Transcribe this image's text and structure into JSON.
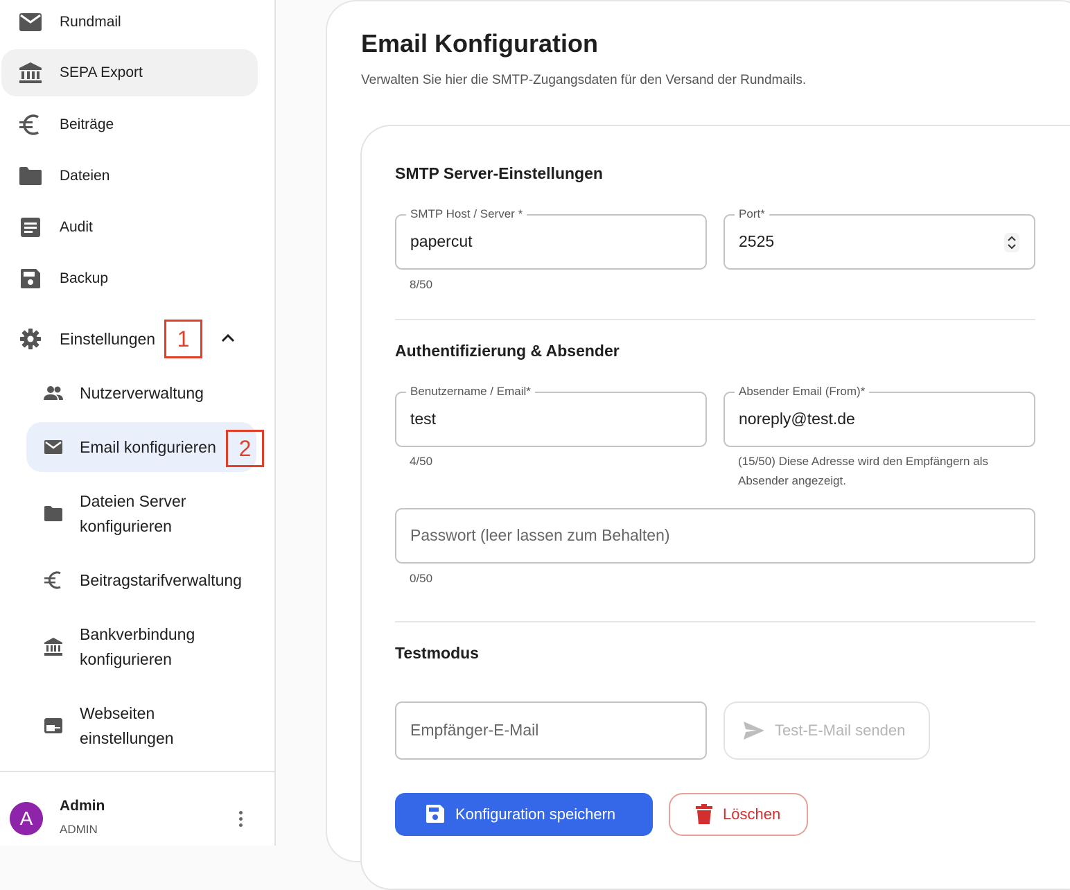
{
  "sidebar": {
    "items": [
      {
        "label": "Rundmail",
        "icon": "mail-icon"
      },
      {
        "label": "SEPA Export",
        "icon": "bank-icon"
      },
      {
        "label": "Beiträge",
        "icon": "euro-icon"
      },
      {
        "label": "Dateien",
        "icon": "folder-icon"
      },
      {
        "label": "Audit",
        "icon": "document-icon"
      },
      {
        "label": "Backup",
        "icon": "save-icon"
      },
      {
        "label": "Einstellungen",
        "icon": "gear-icon"
      }
    ],
    "sub_items": [
      {
        "label": "Nutzerverwaltung",
        "icon": "people-icon"
      },
      {
        "label": "Email konfigurieren",
        "icon": "mail-icon"
      },
      {
        "label": "Dateien Server konfigurieren",
        "icon": "folder-icon"
      },
      {
        "label": "Beitragstarifverwaltung",
        "icon": "euro-icon"
      },
      {
        "label": "Bankverbindung konfigurieren",
        "icon": "bank-icon"
      },
      {
        "label": "Webseiten einstellungen",
        "icon": "web-icon"
      }
    ],
    "markers": [
      "1",
      "2"
    ],
    "user": {
      "initial": "A",
      "name": "Admin",
      "role": "ADMIN",
      "avatar_color": "#8e24aa"
    }
  },
  "page": {
    "title": "Email Konfiguration",
    "subtitle": "Verwalten Sie hier die SMTP-Zugangsdaten für den Versand der Rundmails."
  },
  "smtp": {
    "section_title": "SMTP Server-Einstellungen",
    "host_label": "SMTP Host / Server",
    "host_value": "papercut",
    "host_counter": "8/50",
    "port_label": "Port",
    "port_value": "2525",
    "required_mark": "*"
  },
  "auth": {
    "section_title": "Authentifizierung & Absender",
    "username_label": "Benutzername / Email",
    "username_value": "test",
    "username_counter": "4/50",
    "from_label": "Absender Email (From)",
    "from_value": "noreply@test.de",
    "from_hint": "(15/50) Diese Adresse wird den Empfängern als Absender angezeigt.",
    "password_placeholder": "Passwort (leer lassen zum Behalten)",
    "password_counter": "0/50"
  },
  "test": {
    "section_title": "Testmodus",
    "recipient_placeholder": "Empfänger-E-Mail",
    "send_label": "Test-E-Mail senden"
  },
  "actions": {
    "save_label": "Konfiguration speichern",
    "delete_label": "Löschen"
  },
  "colors": {
    "primary": "#3568e8",
    "danger": "#d32f2f",
    "marker": "#e0402a",
    "selected_bg": "#eaf0fb"
  }
}
